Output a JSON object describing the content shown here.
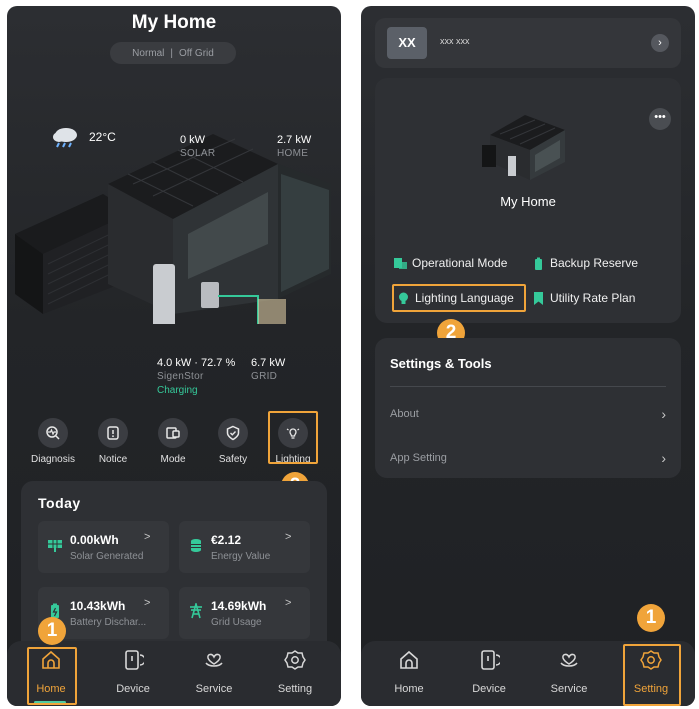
{
  "left": {
    "title": "My Home",
    "mode": {
      "normal": "Normal",
      "sep": "|",
      "offgrid": "Off Grid"
    },
    "weather": {
      "temp": "22°C",
      "icon": "cloud-rain-icon"
    },
    "stats": {
      "solar_value": "0 kW",
      "solar_label": "SOLAR",
      "home_value": "2.7 kW",
      "home_label": "HOME",
      "battery_value": "4.0 kW · 72.7 %",
      "battery_label": "SigenStor",
      "battery_status": "Charging",
      "grid_value": "6.7 kW",
      "grid_label": "GRID"
    },
    "quick_actions": [
      "Diagnosis",
      "Notice",
      "Mode",
      "Safety",
      "Lighting"
    ],
    "today": {
      "title": "Today",
      "tiles": [
        {
          "value": "0.00kWh",
          "label": "Solar Generated",
          "arrow": ">"
        },
        {
          "value": "€2.12",
          "label": "Energy Value",
          "arrow": ">"
        },
        {
          "value": "10.43kWh",
          "label": "Battery Dischar...",
          "arrow": ">"
        },
        {
          "value": "14.69kWh",
          "label": "Grid Usage",
          "arrow": ">"
        }
      ]
    },
    "badges": {
      "one": "1",
      "two": "2"
    }
  },
  "nav": [
    "Home",
    "Device",
    "Service",
    "Setting"
  ],
  "right": {
    "user": {
      "avatar": "XX",
      "name": "xxx xxx",
      "arrow": "›"
    },
    "home": {
      "name": "My Home",
      "more": "•••"
    },
    "features": [
      "Operational Mode",
      "Backup Reserve",
      "Lighting Language",
      "Utility Rate Plan"
    ],
    "settings": {
      "title": "Settings & Tools",
      "rows": [
        "About",
        "App Setting"
      ],
      "chev": "›"
    },
    "badges": {
      "one": "1",
      "two": "2"
    }
  },
  "colors": {
    "accent": "#f0a43a",
    "green": "#35c99a",
    "bg": "#232528",
    "card": "#2e3034"
  }
}
